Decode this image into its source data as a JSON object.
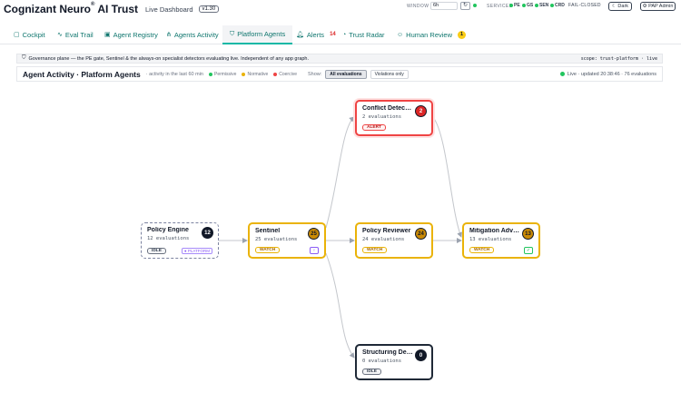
{
  "header": {
    "brand": "Cognizant Neuro",
    "brand_mark": "®",
    "brand_suffix": "AI Trust",
    "subtitle": "Live Dashboard",
    "version": "v1.30",
    "window_label": "WINDOW",
    "window_value": "6h",
    "window_button_icon": "refresh-icon",
    "services_label": "SERVICES",
    "services": [
      {
        "name": "PE",
        "status_color": "#22c55e"
      },
      {
        "name": "GS",
        "status_color": "#22c55e"
      },
      {
        "name": "SEN",
        "status_color": "#22c55e"
      },
      {
        "name": "CRD",
        "status_color": "#22c55e"
      }
    ],
    "fail_mode": "FAIL-CLOSED",
    "dark_label": "Dark",
    "user_label": "PAP Admin"
  },
  "tabs": [
    {
      "label": "Cockpit",
      "icon": "cockpit-icon"
    },
    {
      "label": "Eval Trail",
      "icon": "activity-icon"
    },
    {
      "label": "Agent Registry",
      "icon": "registry-icon"
    },
    {
      "label": "Agents Activity",
      "icon": "graph-icon"
    },
    {
      "label": "Platform Agents",
      "icon": "shield-icon",
      "active": true
    },
    {
      "label": "Alerts",
      "icon": "bell-icon",
      "count": "14"
    },
    {
      "label": "Trust Radar",
      "icon": "radar-icon"
    },
    {
      "label": "Human Review",
      "icon": "person-icon",
      "count": "1"
    }
  ],
  "banner": {
    "text": "Governance plane — the PE gate, Sentinel & the always-on specialist detectors evaluating live. Independent of any app graph.",
    "scope": "scope: trust-platform · live"
  },
  "panel": {
    "title": "Agent Activity · Platform Agents",
    "subtitle": "· activity in the last 60 min",
    "legend": [
      {
        "label": "Permissive",
        "color": "#22c55e"
      },
      {
        "label": "Normative",
        "color": "#eab308"
      },
      {
        "label": "Coercive",
        "color": "#ef4444"
      }
    ],
    "show_label": "Show:",
    "filters": [
      {
        "label": "All evaluations",
        "active": true
      },
      {
        "label": "Violations only",
        "active": false
      }
    ],
    "live_text": "Live · updated 20:38:46 · 76 evaluations"
  },
  "nodes": [
    {
      "id": "policy-engine",
      "name": "Policy Engine",
      "count": "12",
      "evaluations": "12 evaluations",
      "status": "IDLE",
      "tag": "● PLATFORM",
      "style": "idle-dashed"
    },
    {
      "id": "sentinel",
      "name": "Sentinel",
      "count": "25",
      "evaluations": "25 evaluations",
      "status": "WATCH",
      "icon": "user-icon",
      "style": "watch"
    },
    {
      "id": "conflict-detector",
      "name": "Conflict Detector",
      "count": "2",
      "evaluations": "2 evaluations",
      "status": "ALERT",
      "style": "alert"
    },
    {
      "id": "policy-reviewer",
      "name": "Policy Reviewer",
      "count": "24",
      "evaluations": "24 evaluations",
      "status": "WATCH",
      "style": "watch"
    },
    {
      "id": "mitigation-advisor",
      "name": "Mitigation Advisor",
      "count": "13",
      "evaluations": "13 evaluations",
      "status": "WATCH",
      "icon": "check-icon",
      "style": "watch"
    },
    {
      "id": "structuring-detector",
      "name": "Structuring Detector",
      "count": "0",
      "evaluations": "0 evaluations",
      "status": "IDLE",
      "style": "idle-solid"
    }
  ]
}
